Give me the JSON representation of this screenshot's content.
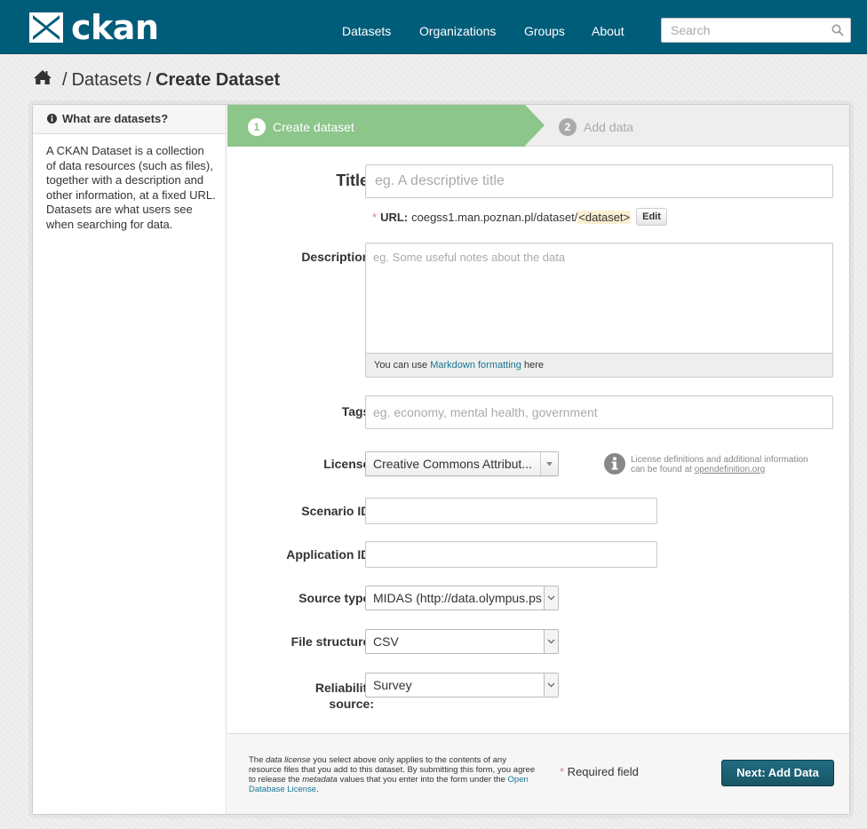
{
  "header": {
    "logo_text": "ckan",
    "nav": [
      "Datasets",
      "Organizations",
      "Groups",
      "About"
    ],
    "search_placeholder": "Search"
  },
  "breadcrumb": {
    "items": [
      "Datasets"
    ],
    "active": "Create Dataset"
  },
  "sidebar": {
    "heading": "What are datasets?",
    "body": "A CKAN Dataset is a collection of data resources (such as files), together with a description and other information, at a fixed URL. Datasets are what users see when searching for data."
  },
  "stages": [
    {
      "number": "1",
      "label": "Create dataset",
      "active": true
    },
    {
      "number": "2",
      "label": "Add data",
      "active": false
    }
  ],
  "form": {
    "title": {
      "label": "Title:",
      "placeholder": "eg. A descriptive title",
      "value": ""
    },
    "url": {
      "star": "*",
      "label": "URL:",
      "prefix": "coegss1.man.poznan.pl/dataset/",
      "slug": "<dataset>",
      "edit_label": "Edit"
    },
    "description": {
      "label": "Description:",
      "placeholder": "eg. Some useful notes about the data",
      "value": ""
    },
    "markdown_note": {
      "before": "You can use ",
      "link": "Markdown formatting",
      "after": " here"
    },
    "tags": {
      "label": "Tags:",
      "placeholder": "eg. economy, mental health, government",
      "value": ""
    },
    "license": {
      "label": "License:",
      "selected": "Creative Commons Attribut...",
      "info_line1": "License definitions and additional information",
      "info_line2_before": "can be found at ",
      "info_link": "opendefinition.org"
    },
    "scenario_id": {
      "label": "Scenario ID:",
      "value": ""
    },
    "application_id": {
      "label": "Application ID:",
      "value": ""
    },
    "source_type": {
      "label": "Source type:",
      "selected": "MIDAS (http://data.olympus.ps"
    },
    "file_structure": {
      "label": "File structure:",
      "selected": "CSV"
    },
    "reliability_source": {
      "label_line1": "Reliability",
      "label_line2": "source:",
      "selected": "Survey"
    }
  },
  "footer": {
    "legal_1": "The ",
    "legal_em1": "data license",
    "legal_2": " you select above only applies to the contents of any resource files that you add to this dataset. By submitting this form, you agree to release the ",
    "legal_em2": "metadata",
    "legal_3": " values that you enter into the form under the ",
    "legal_link": "Open Database License",
    "legal_4": ".",
    "required_star": "*",
    "required_text": " Required field",
    "next_button": "Next: Add Data"
  },
  "colors": {
    "masthead": "#005d7a",
    "stage_active": "#8cc68a",
    "primary_button": "#206b82",
    "link": "#187794",
    "required": "#c6898b"
  }
}
